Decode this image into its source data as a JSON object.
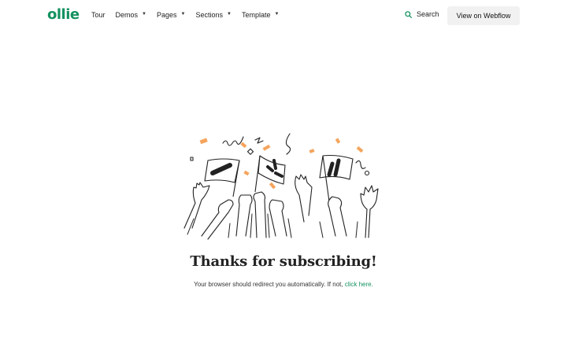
{
  "nav": {
    "logo": "ollie",
    "items": [
      {
        "label": "Tour",
        "has_dropdown": false
      },
      {
        "label": "Demos",
        "has_dropdown": true
      },
      {
        "label": "Pages",
        "has_dropdown": true
      },
      {
        "label": "Sections",
        "has_dropdown": true
      },
      {
        "label": "Template",
        "has_dropdown": true
      }
    ],
    "dropdown_icon": "chevron-down-icon",
    "search_label": "Search",
    "search_icon": "search-icon",
    "cta_label": "View on Webflow"
  },
  "illustration": {
    "name": "celebrating-hands-with-flags",
    "confetti_color": "#f5a45d"
  },
  "main": {
    "title": "Thanks for subscribing!",
    "message": "Your browser should redirect you automatically. If not,",
    "link_text": "click here."
  },
  "colors": {
    "brand": "#14915f",
    "button_bg": "#f1f1f1",
    "text": "#222222"
  }
}
